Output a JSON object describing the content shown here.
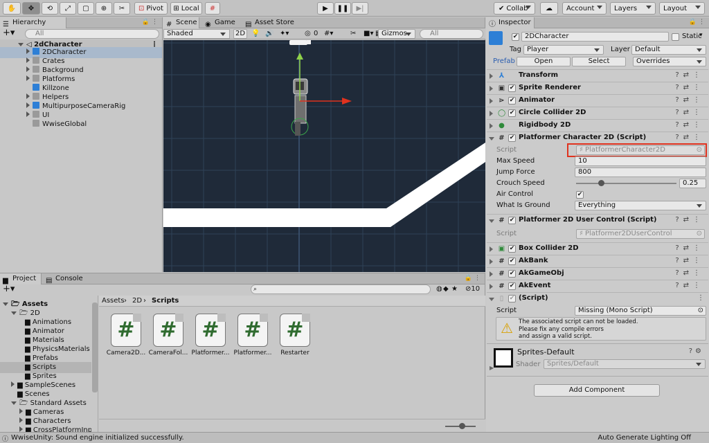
{
  "toolbar": {
    "pivot": "Pivot",
    "local": "Local",
    "collab": "Collab",
    "account": "Account",
    "layers": "Layers",
    "layout": "Layout"
  },
  "hierarchy": {
    "tab": "Hierarchy",
    "search_placeholder": "All",
    "scene": "2dCharacter",
    "items": [
      "2DCharacter",
      "Crates",
      "Background",
      "Platforms",
      "Killzone",
      "Helpers",
      "MultipurposeCameraRig",
      "UI",
      "WwiseGlobal"
    ]
  },
  "scene_view": {
    "tabs": [
      "Scene",
      "Game",
      "Asset Store"
    ],
    "shading": "Shaded",
    "mode_2d": "2D",
    "hidden_count": "0",
    "gizmos": "Gizmos",
    "search_placeholder": "All"
  },
  "project": {
    "tabs": [
      "Project",
      "Console"
    ],
    "breadcrumb": [
      "Assets",
      "2D",
      "Scripts"
    ],
    "hidden_count": "10",
    "tree": [
      "Assets",
      "2D",
      "Animations",
      "Animator",
      "Materials",
      "PhysicsMaterials",
      "Prefabs",
      "Scripts",
      "Sprites",
      "SampleScenes",
      "Scenes",
      "Standard Assets",
      "Cameras",
      "Characters",
      "CrossPlatformInpu"
    ],
    "files": [
      "Camera2D...",
      "CameraFol...",
      "Platformer...",
      "Platformer...",
      "Restarter"
    ]
  },
  "inspector": {
    "tab": "Inspector",
    "object_name": "2DCharacter",
    "static_label": "Static",
    "tag_label": "Tag",
    "tag_value": "Player",
    "layer_label": "Layer",
    "layer_value": "Default",
    "prefab_label": "Prefab",
    "open_btn": "Open",
    "select_btn": "Select",
    "overrides": "Overrides",
    "components": {
      "transform": "Transform",
      "sprite_renderer": "Sprite Renderer",
      "animator": "Animator",
      "circle_collider": "Circle Collider 2D",
      "rigidbody": "Rigidbody 2D",
      "platformer_char": "Platformer Character 2D (Script)",
      "user_control": "Platformer 2D User Control (Script)",
      "box_collider": "Box Collider 2D",
      "akbank": "AkBank",
      "akgameobj": "AkGameObj",
      "akevent": "AkEvent",
      "script_missing": "(Script)"
    },
    "props": {
      "script_label": "Script",
      "script_value": "PlatformerCharacter2D",
      "max_speed_label": "Max Speed",
      "max_speed": "10",
      "jump_force_label": "Jump Force",
      "jump_force": "800",
      "crouch_label": "Crouch Speed",
      "crouch_value": "0.25",
      "crouch_fraction": 0.25,
      "air_control_label": "Air Control",
      "what_is_ground_label": "What Is Ground",
      "what_is_ground": "Everything"
    },
    "user_control_script_label": "Script",
    "user_control_script": "Platformer2DUserControl",
    "missing_script_label": "Script",
    "missing_script_value": "Missing (Mono Script)",
    "warning": "The associated script can not be loaded.\nPlease fix any compile errors\nand assign a valid script.",
    "material_name": "Sprites-Default",
    "shader_label": "Shader",
    "shader_value": "Sprites/Default",
    "add_component": "Add Component"
  },
  "status": {
    "message": "WwiseUnity: Sound engine initialized successfully.",
    "right": "Auto Generate Lighting Off"
  },
  "colors": {
    "highlight": "#e0321e",
    "scene_bg": "#1f2a39",
    "selection": "#a9b9cc"
  }
}
